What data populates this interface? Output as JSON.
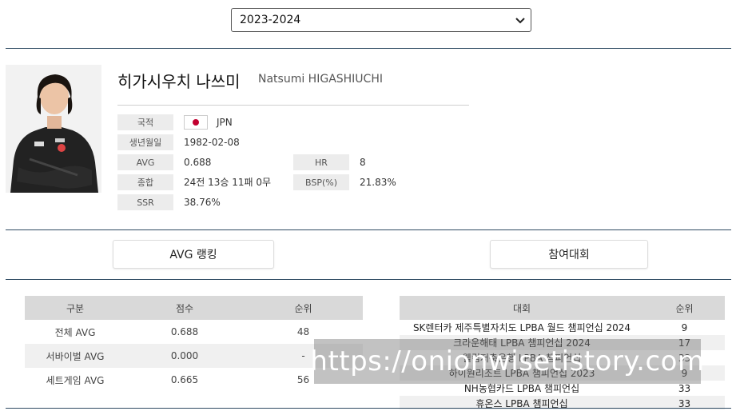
{
  "season": {
    "selected": "2023-2024"
  },
  "player": {
    "name_ko": "히가시우치 나쓰미",
    "name_en": "Natsumi HIGASHIUCHI",
    "fields": {
      "nationality": {
        "label": "국적",
        "value": "JPN"
      },
      "birth": {
        "label": "생년월일",
        "value": "1982-02-08"
      },
      "avg": {
        "label": "AVG",
        "value": "0.688"
      },
      "hr": {
        "label": "HR",
        "value": "8"
      },
      "record": {
        "label": "종합",
        "value": "24전 13승 11패 0무"
      },
      "bsp": {
        "label": "BSP(%)",
        "value": "21.83%"
      },
      "ssr": {
        "label": "SSR",
        "value": "38.76%"
      }
    }
  },
  "buttons": {
    "avg_ranking": "AVG 랭킹",
    "tournaments": "참여대회"
  },
  "avg_table": {
    "headers": [
      "구분",
      "점수",
      "순위"
    ],
    "rows": [
      [
        "전체 AVG",
        "0.688",
        "48"
      ],
      [
        "서바이벌 AVG",
        "0.000",
        "-"
      ],
      [
        "세트게임 AVG",
        "0.665",
        "56"
      ]
    ]
  },
  "tournament_table": {
    "headers": [
      "대회",
      "순위"
    ],
    "rows": [
      [
        "SK렌터카 제주특별자치도 LPBA 월드 챔피언십 2024",
        "9"
      ],
      [
        "크라운해태 LPBA 챔피언십 2024",
        "17"
      ],
      [
        "웰컴저축은행 LPBA 챔피언십",
        "33"
      ],
      [
        "하이원리조트 LPBA 챔피언십 2023",
        "9"
      ],
      [
        "NH농협카드 LPBA 챔피언십",
        "33"
      ],
      [
        "휴온스 LPBA 챔피언십",
        "33"
      ]
    ]
  },
  "watermark": "https://onionwisetistory.com",
  "colors": {
    "divider": "#2e4a62",
    "flag_red": "#c2002f",
    "header_gray": "#d9d9d9"
  }
}
